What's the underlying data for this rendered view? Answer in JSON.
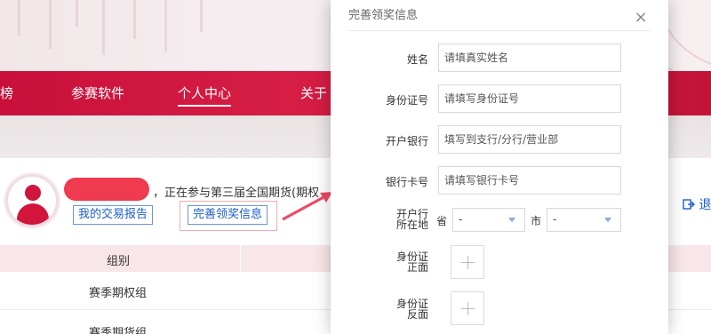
{
  "nav": {
    "items": [
      "榜",
      "参赛软件",
      "个人中心",
      "关于"
    ],
    "active_index": 2
  },
  "profile": {
    "participation_text": "，正在参与第三届全国期货(期权",
    "report_button": "我的交易报告",
    "prize_info_button": "完善领奖信息",
    "exit_label": "退"
  },
  "table": {
    "header_group": "组别",
    "rows": [
      "赛季期权组",
      "赛季期货组"
    ]
  },
  "modal": {
    "title": "完善领奖信息",
    "close_glyph": "×",
    "fields": {
      "name": {
        "label": "姓名",
        "placeholder": "请填真实姓名"
      },
      "id_number": {
        "label": "身份证号",
        "placeholder": "请填写身份证号"
      },
      "bank": {
        "label": "开户银行",
        "placeholder": "填写到支行/分行/营业部"
      },
      "card_number": {
        "label": "银行卡号",
        "placeholder": "请填写银行卡号"
      }
    },
    "location": {
      "label_line1": "开户行",
      "label_line2": "所在地",
      "province_label": "省",
      "province_value": "-",
      "city_label": "市",
      "city_value": "-"
    },
    "id_front": {
      "label_line1": "身份证",
      "label_line2": "正面"
    },
    "id_back": {
      "label_line1": "身份证",
      "label_line2": "反面"
    }
  },
  "colors": {
    "brand_red": "#d2153c",
    "link_blue": "#1c5ec9"
  }
}
